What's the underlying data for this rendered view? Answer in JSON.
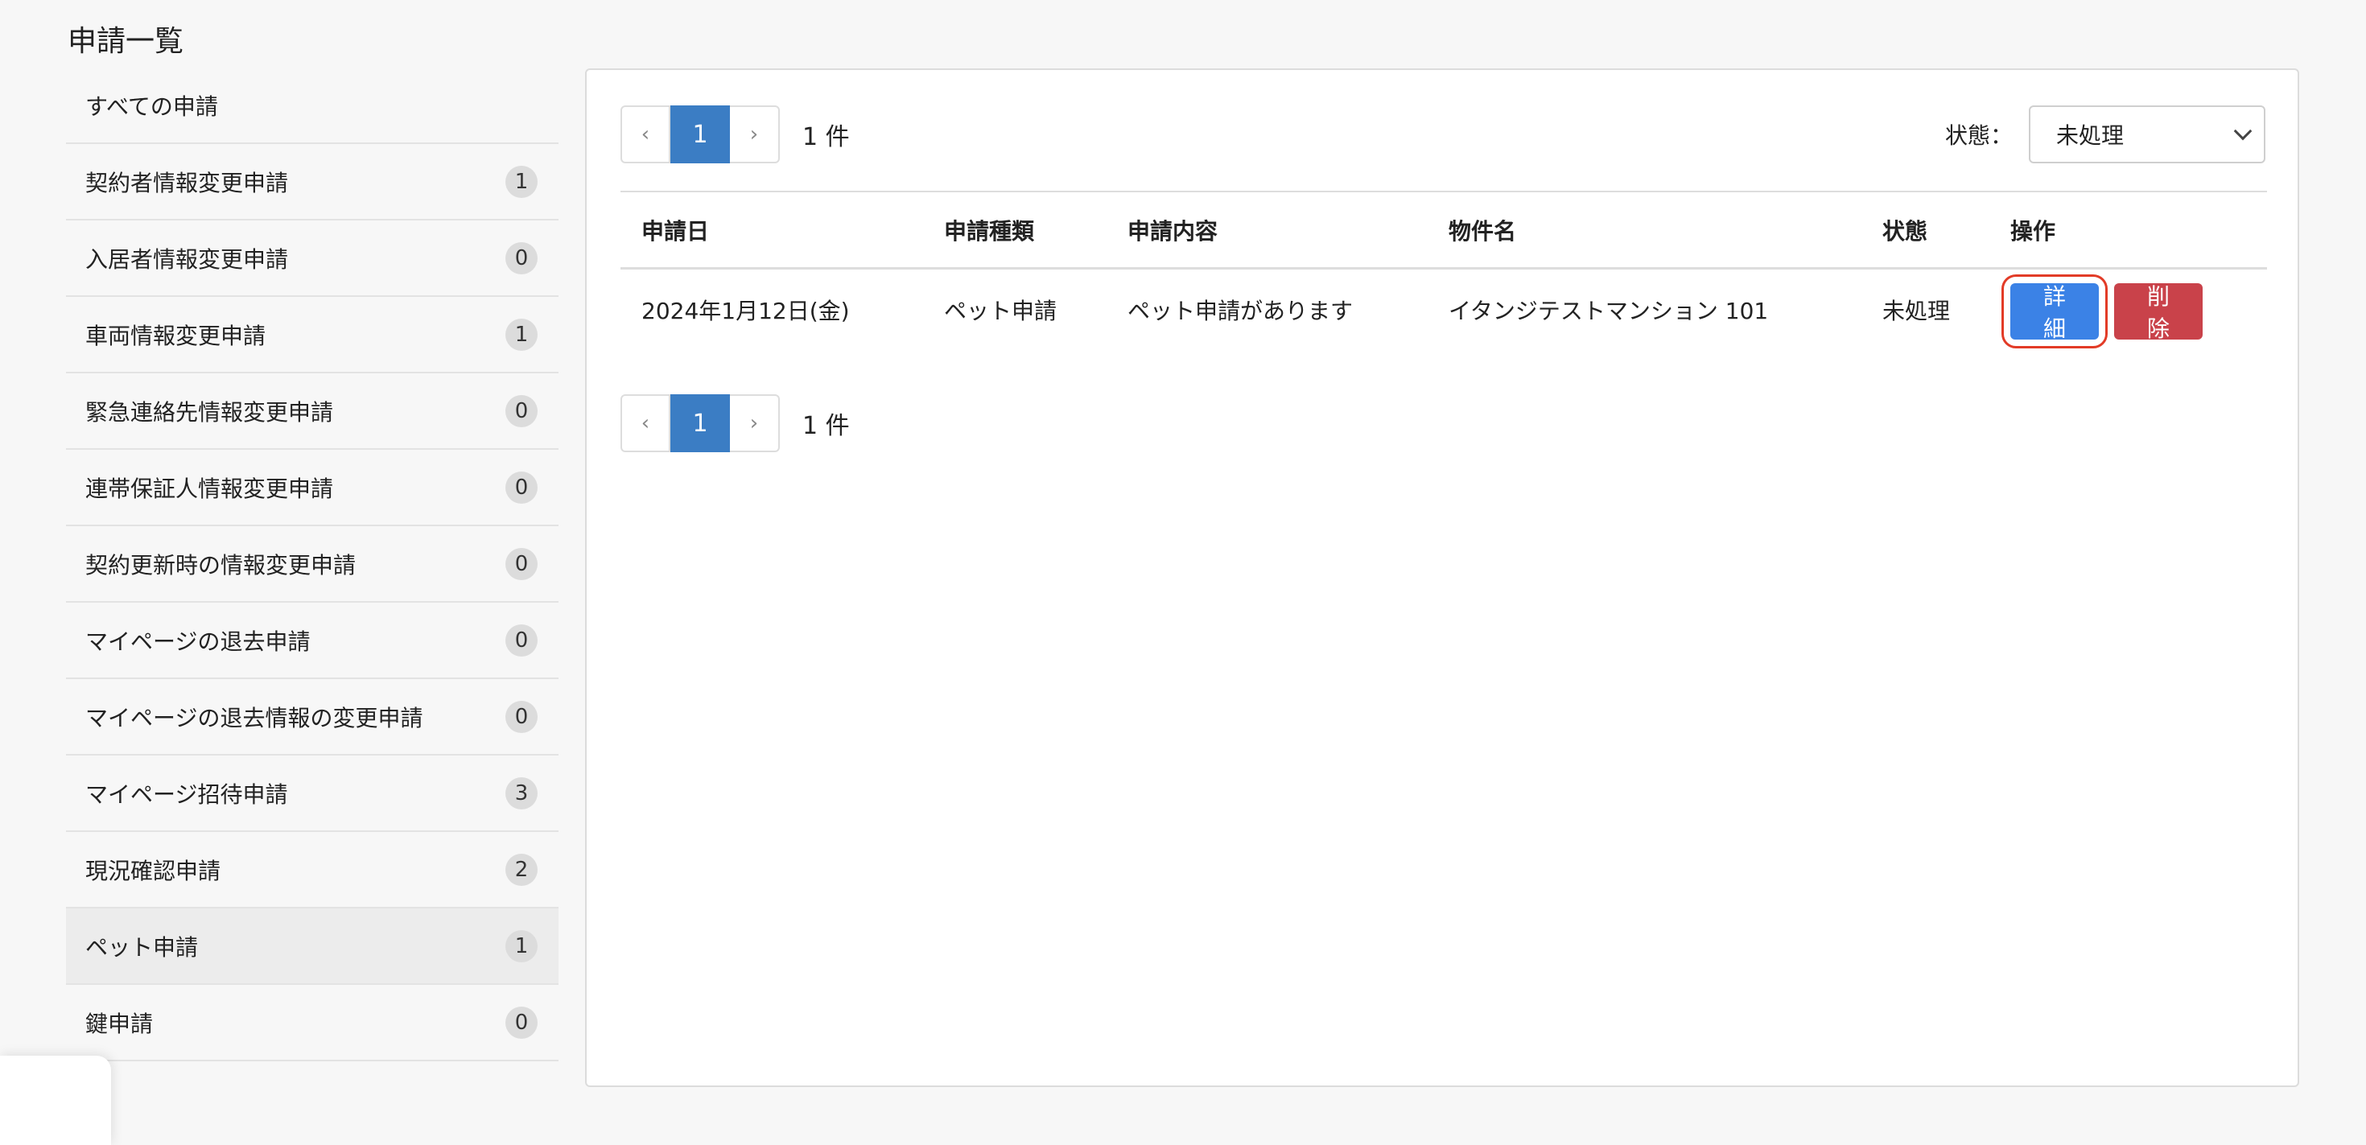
{
  "page_title": "申請一覧",
  "sidebar": {
    "items": [
      {
        "label": "すべての申請",
        "count": null,
        "active": false
      },
      {
        "label": "契約者情報変更申請",
        "count": "1",
        "active": false
      },
      {
        "label": "入居者情報変更申請",
        "count": "0",
        "active": false
      },
      {
        "label": "車両情報変更申請",
        "count": "1",
        "active": false
      },
      {
        "label": "緊急連絡先情報変更申請",
        "count": "0",
        "active": false
      },
      {
        "label": "連帯保証人情報変更申請",
        "count": "0",
        "active": false
      },
      {
        "label": "契約更新時の情報変更申請",
        "count": "0",
        "active": false
      },
      {
        "label": "マイページの退去申請",
        "count": "0",
        "active": false
      },
      {
        "label": "マイページの退去情報の変更申請",
        "count": "0",
        "active": false
      },
      {
        "label": "マイページ招待申請",
        "count": "3",
        "active": false
      },
      {
        "label": "現況確認申請",
        "count": "2",
        "active": false
      },
      {
        "label": "ペット申請",
        "count": "1",
        "active": true
      },
      {
        "label": "鍵申請",
        "count": "0",
        "active": false
      }
    ]
  },
  "pagination": {
    "prev": "‹",
    "next": "›",
    "current": "1",
    "count_text": "1 件"
  },
  "filter": {
    "label": "状態：",
    "selected": "未処理"
  },
  "table": {
    "headers": [
      "申請日",
      "申請種類",
      "申請内容",
      "物件名",
      "状態",
      "操作"
    ],
    "rows": [
      {
        "date": "2024年1月12日(金)",
        "type": "ペット申請",
        "content": "ペット申請があります",
        "property": "イタンジテストマンション 101",
        "status": "未処理"
      }
    ],
    "actions": {
      "detail": "詳細",
      "delete": "削除"
    }
  },
  "colors": {
    "primary": "#3b82e6",
    "pager_active": "#3b7dc4",
    "danger": "#c9424a",
    "highlight": "#e23b27"
  }
}
